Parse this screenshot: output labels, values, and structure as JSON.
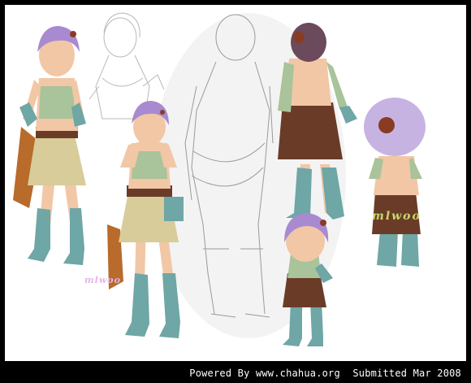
{
  "caption": {
    "powered": "Powered By www.chahua.org",
    "submitted": "Submitted Mar 2008"
  },
  "signatures": {
    "artist_green": "mlwoo",
    "artist_pink": "mlwoo"
  },
  "colors": {
    "hair": "#a88ad0",
    "skin": "#f1c7a6",
    "boots": "#6fa6a6",
    "skirt": "#d8cc9a",
    "leather": "#6a3c28",
    "cape": "#b86b2a",
    "top": "#a9c39a",
    "sketch": "#9a9a9a"
  }
}
